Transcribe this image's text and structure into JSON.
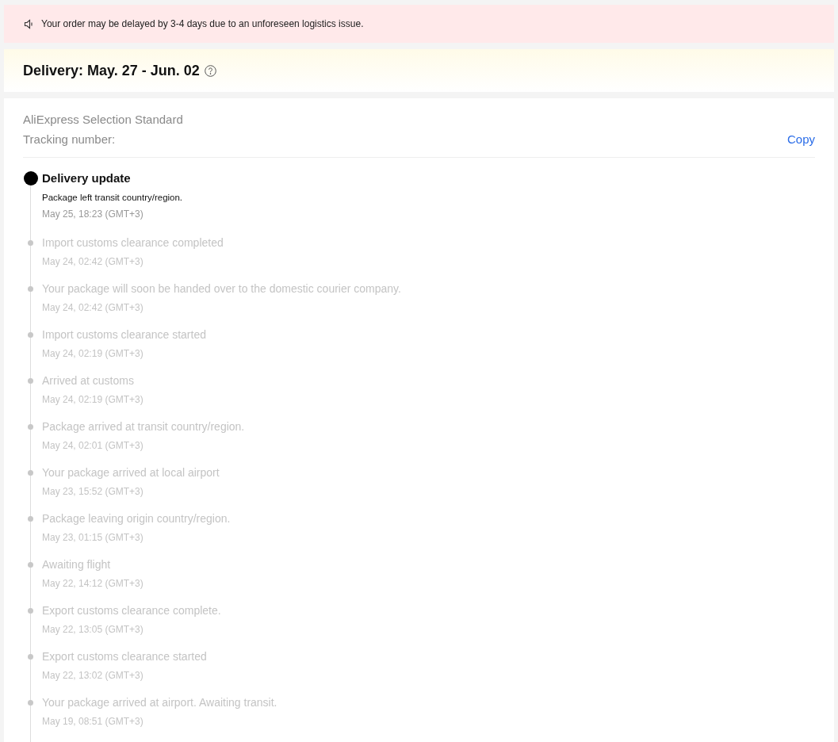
{
  "notice": {
    "text": "Your order may be delayed by 3-4 days due to an unforeseen logistics issue."
  },
  "delivery": {
    "title": "Delivery: May. 27 - Jun. 02"
  },
  "shipping": {
    "carrier": "AliExpress Selection Standard",
    "tracking_label": "Tracking number:",
    "copy_link": "Copy"
  },
  "events": [
    {
      "kind": "current",
      "title": "Delivery update",
      "description": "Package left transit country/region.",
      "time": "May 25, 18:23 (GMT+3)"
    },
    {
      "kind": "past",
      "title": "Import customs clearance completed",
      "time": "May 24, 02:42 (GMT+3)"
    },
    {
      "kind": "past",
      "title": "Your package will soon be handed over to the domestic courier company.",
      "time": "May 24, 02:42 (GMT+3)"
    },
    {
      "kind": "past",
      "title": "Import customs clearance started",
      "time": "May 24, 02:19 (GMT+3)"
    },
    {
      "kind": "past",
      "title": "Arrived at customs",
      "time": "May 24, 02:19 (GMT+3)"
    },
    {
      "kind": "past",
      "title": "Package arrived at transit country/region.",
      "time": "May 24, 02:01 (GMT+3)"
    },
    {
      "kind": "past",
      "title": "Your package arrived at local airport",
      "time": "May 23, 15:52 (GMT+3)"
    },
    {
      "kind": "past",
      "title": "Package leaving origin country/region.",
      "time": "May 23, 01:15 (GMT+3)"
    },
    {
      "kind": "past",
      "title": "Awaiting flight",
      "time": "May 22, 14:12 (GMT+3)"
    },
    {
      "kind": "past",
      "title": "Export customs clearance complete.",
      "time": "May 22, 13:05 (GMT+3)"
    },
    {
      "kind": "past",
      "title": "Export customs clearance started",
      "time": "May 22, 13:02 (GMT+3)"
    },
    {
      "kind": "past",
      "title": "Your package arrived at airport. Awaiting transit.",
      "time": "May 19, 08:51 (GMT+3)"
    }
  ]
}
